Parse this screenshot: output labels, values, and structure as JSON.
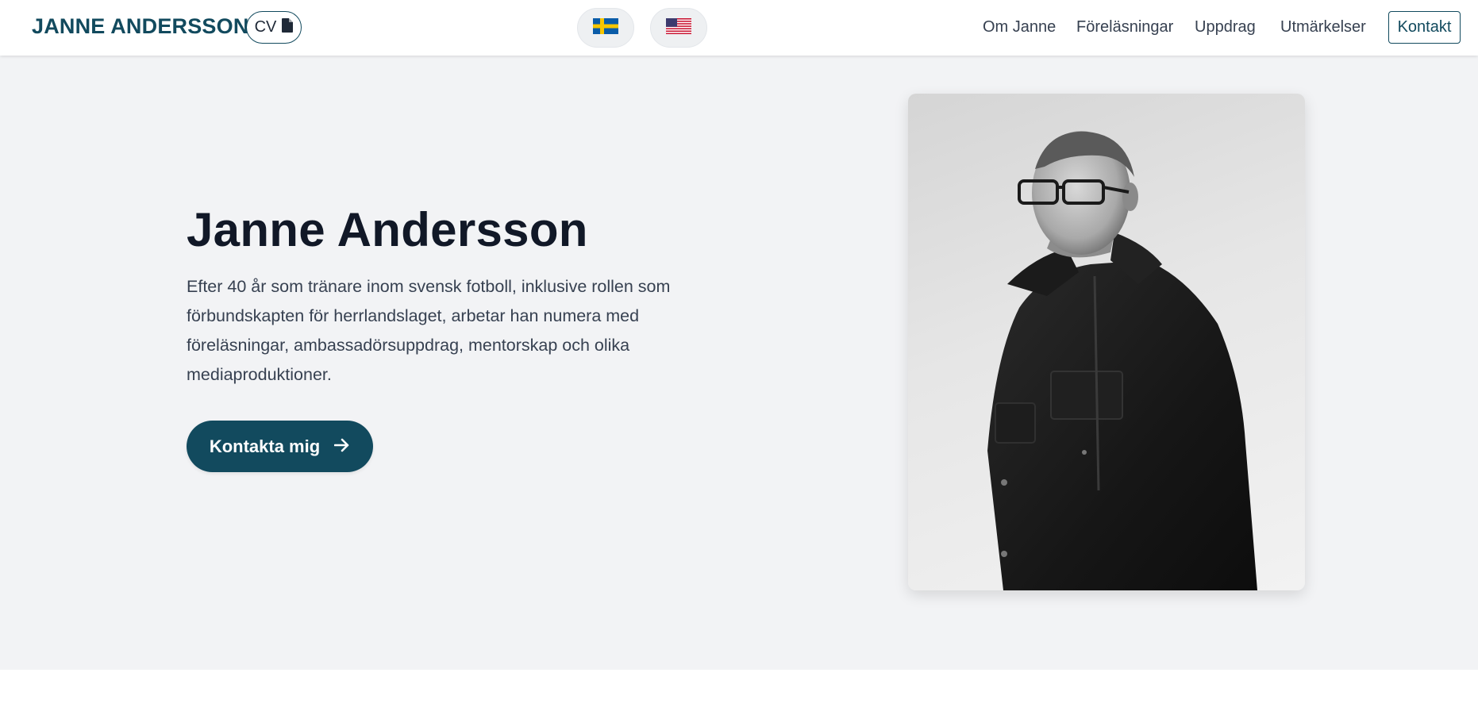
{
  "header": {
    "brand": "JANNE ANDERSSON",
    "cv_label": "CV",
    "cv_icon": "file-icon",
    "languages": [
      {
        "code": "sv",
        "icon": "sweden-flag-icon"
      },
      {
        "code": "en",
        "icon": "us-flag-icon"
      }
    ],
    "nav": {
      "om": "Om Janne",
      "forelasningar": "Föreläsningar",
      "uppdrag": "Uppdrag",
      "utmarkelser": "Utmärkelser",
      "kontakt": "Kontakt"
    }
  },
  "hero": {
    "title": "Janne Andersson",
    "description": "Efter 40 år som tränare inom svensk fotboll, inklusive rollen som förbundskapten för herrlandslaget, arbetar han numera med föreläsningar, ambassadörsuppdrag, mentorskap och olika mediaproduktioner.",
    "cta_label": "Kontakta mig",
    "cta_icon": "arrow-right-icon",
    "photo": "portrait-photo"
  },
  "colors": {
    "brand": "#124a5e",
    "hero_bg": "#f2f3f5",
    "title": "#111827",
    "text": "#374151"
  }
}
